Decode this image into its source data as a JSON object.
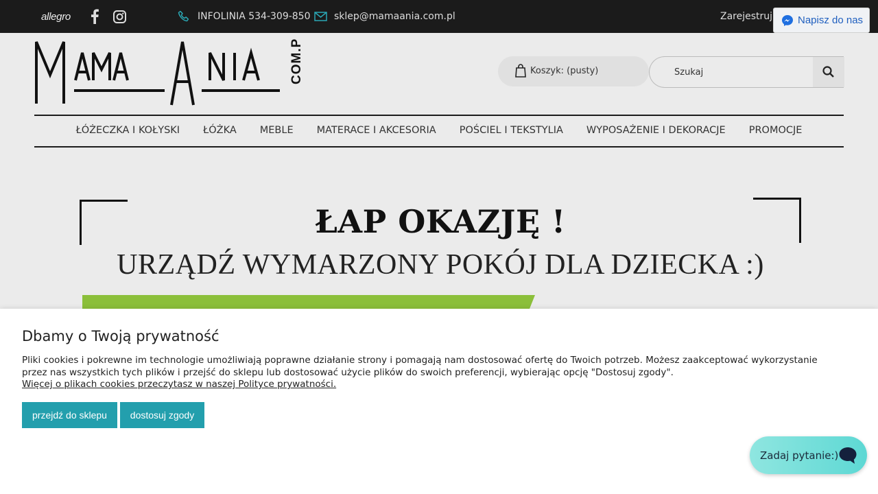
{
  "topbar": {
    "allegro": "allegro",
    "phone": "INFOLINIA 534-309-850",
    "email": "sklep@mamaania.com.pl",
    "register": "Zarejestruj się"
  },
  "messenger": {
    "label": "Napisz do nas"
  },
  "logo": {
    "main": "MAMAANIA",
    "suffix": "COM.PL"
  },
  "cart": {
    "label": "Koszyk: (pusty)"
  },
  "search": {
    "placeholder": "Szukaj"
  },
  "nav": {
    "items": [
      "ŁÓŻECZKA I KOŁYSKI",
      "ŁÓŻKA",
      "MEBLE",
      "MATERACE I AKCESORIA",
      "POŚCIEL I TEKSTYLIA",
      "WYPOSAŻENIE I DEKORACJE",
      "PROMOCJE"
    ]
  },
  "hero": {
    "title": "ŁAP OKAZJĘ !",
    "subtitle": "URZĄDŹ WYMARZONY POKÓJ DLA DZIECKA :)"
  },
  "cookie": {
    "title": "Dbamy o Twoją prywatność",
    "text": "Pliki cookies i pokrewne im technologie umożliwiają poprawne działanie strony i pomagają nam dostosować ofertę do Twoich potrzeb. Możesz zaakceptować wykorzystanie przez nas wszystkich tych plików i przejść do sklepu lub dostosować użycie plików do swoich preferencji, wybierając opcję \"Dostosuj zgody\".",
    "link": "Więcej o plikach cookies przeczytasz w naszej Polityce prywatności.",
    "accept_label": "przejdź do sklepu",
    "customize_label": "dostosuj zgody"
  },
  "chat": {
    "label": "Zadaj pytanie:)"
  },
  "colors": {
    "accent": "#239fad",
    "topbar": "#1b1b1b",
    "chat": "#5dd8d4",
    "messenger": "#1f5fbf"
  }
}
